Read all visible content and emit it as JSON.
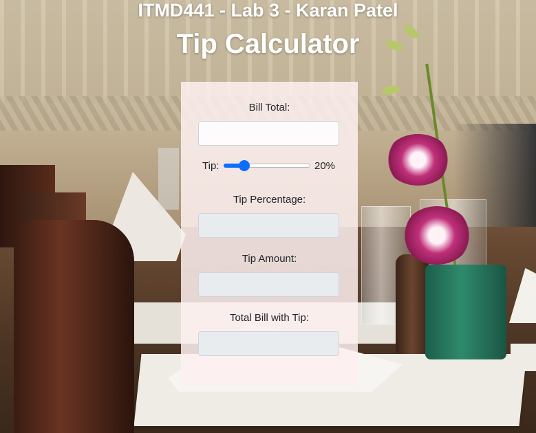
{
  "header": {
    "subtitle": "ITMD441 - Lab 3 - Karan Patel",
    "title": "Tip Calculator"
  },
  "form": {
    "bill_total_label": "Bill Total:",
    "bill_total_value": "",
    "tip_label": "Tip:",
    "tip_value_text": "20%",
    "tip_slider_fraction": 0.2,
    "tip_percentage_label": "Tip Percentage:",
    "tip_percentage_value": "",
    "tip_amount_label": "Tip Amount:",
    "tip_amount_value": "",
    "total_with_tip_label": "Total Bill with Tip:",
    "total_with_tip_value": ""
  },
  "colors": {
    "accent": "#0d6efd",
    "card_background": "#fdf0f0",
    "title_text": "#ffffff"
  }
}
